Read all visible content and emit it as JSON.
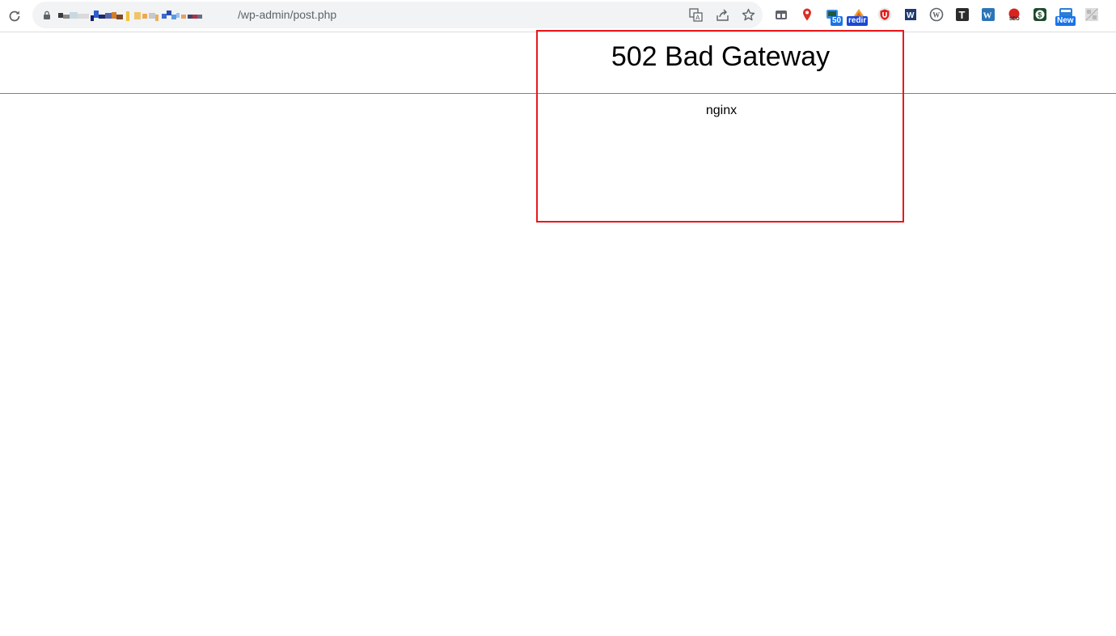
{
  "browser": {
    "url_suffix": "/wp-admin/post.php",
    "url_prefix_redacted": true,
    "icons": {
      "reload": "reload-icon",
      "lock": "lock-icon",
      "translate": "translate-icon",
      "share": "share-icon",
      "bookmark": "star-icon"
    },
    "extensions": [
      {
        "name": "extension-tabs-icon"
      },
      {
        "name": "extension-map-pin-icon"
      },
      {
        "name": "extension-camera-icon",
        "badge": "50",
        "badge_color": "#1a73e8"
      },
      {
        "name": "extension-redirect-icon",
        "badge": "redir",
        "badge_color": "#1a47d6"
      },
      {
        "name": "extension-ublock-icon"
      },
      {
        "name": "extension-word-icon"
      },
      {
        "name": "extension-wordpress-icon"
      },
      {
        "name": "extension-t-icon"
      },
      {
        "name": "extension-wp-blue-icon"
      },
      {
        "name": "extension-seo-icon"
      },
      {
        "name": "extension-dollar-icon"
      },
      {
        "name": "extension-new-icon",
        "badge": "New",
        "badge_color": "#1a73e8"
      },
      {
        "name": "extension-puzzle-icon"
      }
    ]
  },
  "page": {
    "heading": "502 Bad Gateway",
    "server": "nginx"
  },
  "colors": {
    "highlight": "#e8191c",
    "rule": "#808080"
  }
}
